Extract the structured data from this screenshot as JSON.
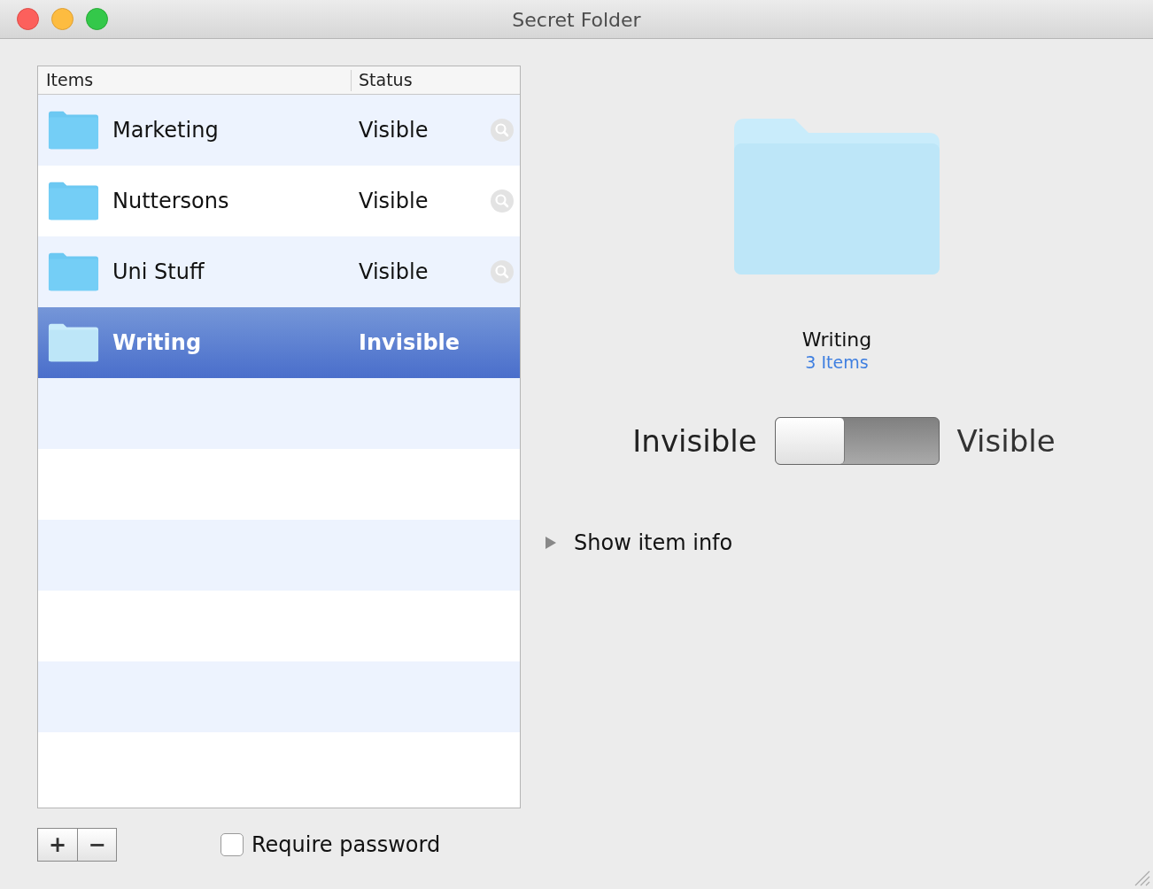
{
  "window": {
    "title": "Secret Folder"
  },
  "table": {
    "columns": [
      "Items",
      "Status"
    ],
    "rows": [
      {
        "name": "Marketing",
        "status": "Visible",
        "selected": false
      },
      {
        "name": "Nuttersons",
        "status": "Visible",
        "selected": false
      },
      {
        "name": "Uni Stuff",
        "status": "Visible",
        "selected": false
      },
      {
        "name": "Writing",
        "status": "Invisible",
        "selected": true
      }
    ]
  },
  "list_buttons": [
    "+",
    "−"
  ],
  "require_password": {
    "label": "Require password",
    "checked": false
  },
  "preview": {
    "name": "Writing",
    "count": "3 Items"
  },
  "toggle": {
    "off_label": "Invisible",
    "on_label": "Visible",
    "on": false
  },
  "disclosure": {
    "label": "Show item info",
    "expanded": false
  }
}
